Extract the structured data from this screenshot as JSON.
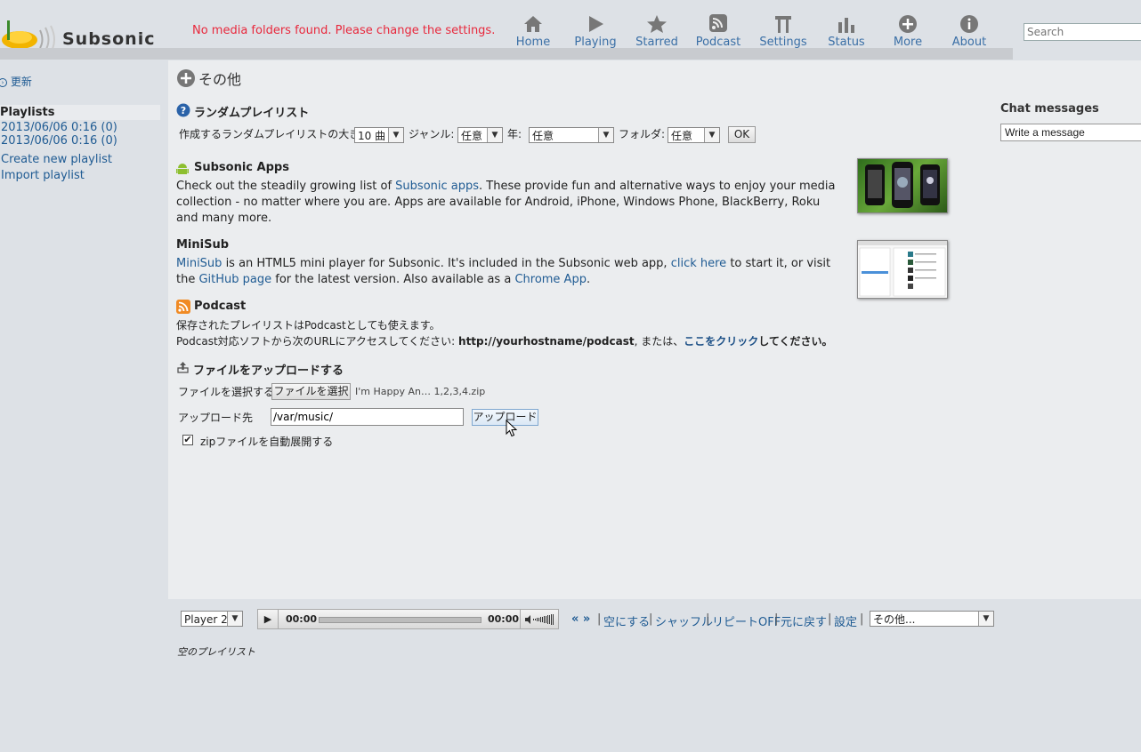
{
  "header": {
    "app_name": "Subsonic",
    "warning": "No media folders found. Please change the settings.",
    "nav": [
      {
        "label": "Home",
        "icon": "home-icon"
      },
      {
        "label": "Playing",
        "icon": "play-icon"
      },
      {
        "label": "Starred",
        "icon": "star-icon"
      },
      {
        "label": "Podcast",
        "icon": "podcast-icon"
      },
      {
        "label": "Settings",
        "icon": "settings-icon"
      },
      {
        "label": "Status",
        "icon": "status-icon"
      },
      {
        "label": "More",
        "icon": "more-icon"
      },
      {
        "label": "About",
        "icon": "about-icon"
      }
    ],
    "search_placeholder": "Search"
  },
  "sidebar": {
    "refresh": "更新",
    "playlists_title": "Playlists",
    "playlists": [
      "2013/06/06 0:16 (0)",
      "2013/06/06 0:16 (0)"
    ],
    "create": "Create new playlist",
    "import": "Import playlist"
  },
  "main": {
    "title": "その他",
    "random": {
      "title": "ランダムプレイリスト",
      "size_label": "作成するランダムプレイリストの大きさ",
      "size_value": "10 曲",
      "genre_label": "ジャンル:",
      "genre_value": "任意",
      "year_label": "年:",
      "year_value": "任意",
      "folder_label": "フォルダ:",
      "folder_value": "任意",
      "ok": "OK"
    },
    "apps": {
      "title": "Subsonic Apps",
      "line1_a": "Check out the steadily growing list of ",
      "line1_link": "Subsonic apps",
      "line1_b": ". These provide fun and alternative ways to enjoy your media",
      "line2": "collection - no matter where you are. Apps are available for Android, iPhone, Windows Phone, BlackBerry, Roku",
      "line3": "and many more."
    },
    "minisub": {
      "title": "MiniSub",
      "link1": "MiniSub",
      "text1": " is an HTML5 mini player for Subsonic. It's included in the Subsonic web app, ",
      "link2": "click here",
      "text2": " to start it, or visit",
      "text3": "the ",
      "link3": "GitHub page",
      "text4": " for the latest version. Also available as a ",
      "link4": "Chrome App",
      "text5": "."
    },
    "podcast": {
      "title": "Podcast",
      "line1": "保存されたプレイリストはPodcastとしても使えます。",
      "line2_a": "Podcast対応ソフトから次のURLにアクセスしてください: ",
      "line2_url": "http://yourhostname/podcast",
      "line2_b": ", または、",
      "line2_link": "ここをクリック",
      "line2_c": "してください。"
    },
    "upload": {
      "title": "ファイルをアップロードする",
      "choose_label": "ファイルを選択する",
      "choose_button": "ファイルを選択",
      "chosen_file": "I'm Happy An… 1,2,3,4.zip",
      "dest_label": "アップロード先",
      "dest_value": "/var/music/",
      "upload_button": "アップロード",
      "unzip_label": "zipファイルを自動展開する",
      "unzip_checked": true
    }
  },
  "chat": {
    "title": "Chat messages",
    "placeholder": "Write a message"
  },
  "player": {
    "player_select": "Player 2",
    "time_current": "00:00",
    "time_total": "00:00",
    "prev_next": "« »",
    "clear": "空にする",
    "shuffle": "シャッフル",
    "repeat": "リピートOFF",
    "undo": "元に戻す",
    "settings": "設定",
    "more_select": "その他...",
    "empty_playlist": "空のプレイリスト"
  }
}
